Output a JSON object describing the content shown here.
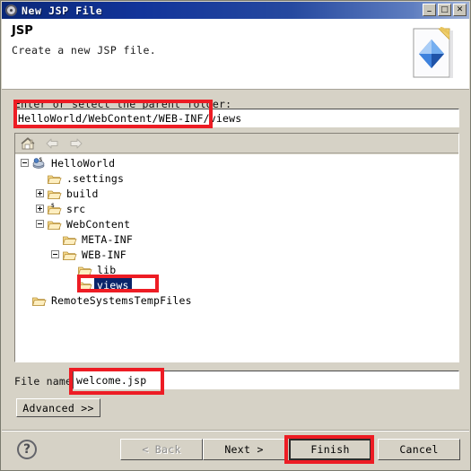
{
  "window": {
    "title": "New JSP File",
    "icon": "gear-icon",
    "controls": {
      "minimize": "_",
      "maximize": "□",
      "close": "✕"
    }
  },
  "banner": {
    "title": "JSP",
    "description": "Create a new JSP file.",
    "icon": "jsp-file-icon"
  },
  "form": {
    "parent_folder_label": "Enter or select the parent folder:",
    "parent_folder_value": "HelloWorld/WebContent/WEB-INF/views",
    "file_name_label": "File name:",
    "file_name_value": "welcome.jsp",
    "advanced_label": "Advanced >>"
  },
  "tree_toolbar": {
    "home": "home-icon",
    "back": "back-arrow-icon",
    "forward": "forward-arrow-icon"
  },
  "tree": [
    {
      "label": "HelloWorld",
      "depth": 0,
      "state": "expanded",
      "icon": "project-icon",
      "selected": false
    },
    {
      "label": ".settings",
      "depth": 1,
      "state": "leaf",
      "icon": "folder-icon",
      "selected": false
    },
    {
      "label": "build",
      "depth": 1,
      "state": "collapsed",
      "icon": "folder-icon",
      "selected": false
    },
    {
      "label": "src",
      "depth": 1,
      "state": "collapsed",
      "icon": "source-folder-icon",
      "selected": false
    },
    {
      "label": "WebContent",
      "depth": 1,
      "state": "expanded",
      "icon": "folder-icon",
      "selected": false
    },
    {
      "label": "META-INF",
      "depth": 2,
      "state": "leaf",
      "icon": "folder-icon",
      "selected": false
    },
    {
      "label": "WEB-INF",
      "depth": 2,
      "state": "expanded",
      "icon": "folder-icon",
      "selected": false
    },
    {
      "label": "lib",
      "depth": 3,
      "state": "leaf",
      "icon": "folder-icon",
      "selected": false
    },
    {
      "label": "views",
      "depth": 3,
      "state": "leaf",
      "icon": "folder-icon",
      "selected": true
    },
    {
      "label": "RemoteSystemsTempFiles",
      "depth": 0,
      "state": "leaf",
      "icon": "folder-icon",
      "selected": false
    }
  ],
  "footer": {
    "help": "?",
    "back_label": "< Back",
    "next_label": "Next >",
    "finish_label": "Finish",
    "cancel_label": "Cancel"
  },
  "colors": {
    "titlebar_blue": "#0a2878",
    "dialog_background": "#d6d2c6",
    "selection_blue": "#0a246a",
    "annotation_red": "#ed1c24",
    "folder_yellow": "#f8d77a"
  }
}
